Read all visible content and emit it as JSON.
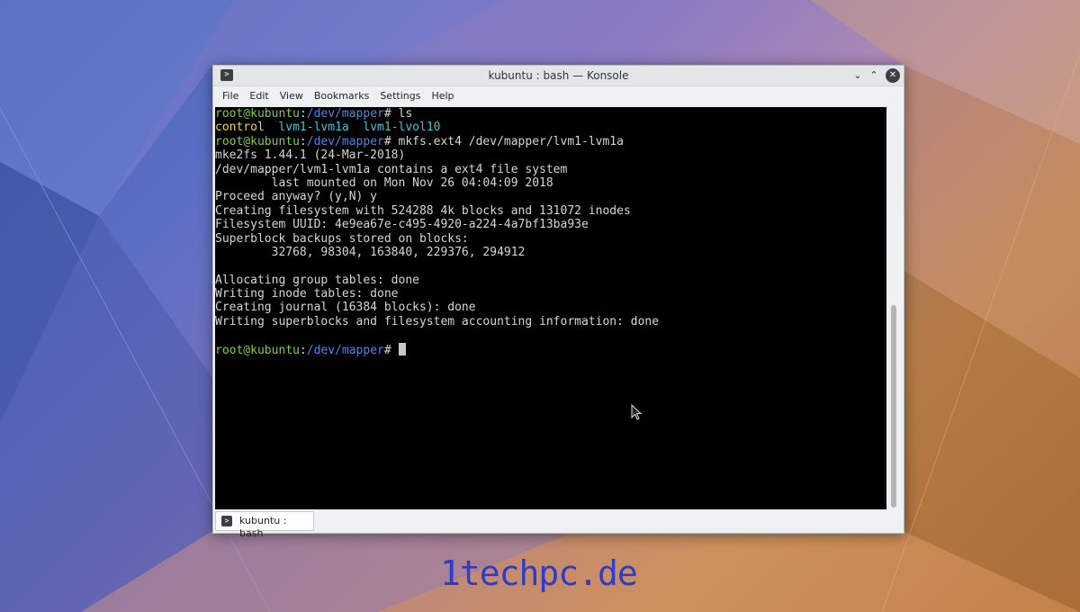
{
  "window": {
    "title": "kubuntu : bash — Konsole",
    "app_icon": "terminal-icon",
    "buttons": [
      "minimize-icon",
      "maximize-icon",
      "close-icon"
    ]
  },
  "menu": [
    "File",
    "Edit",
    "View",
    "Bookmarks",
    "Settings",
    "Help"
  ],
  "terminal": {
    "prompt": {
      "user_host": "root@kubuntu",
      "sep": ":",
      "path": "/dev/mapper",
      "symbol": "# "
    },
    "command1": "ls",
    "ls_output": {
      "control": "control",
      "lvm1": "lvm1-lvm1a",
      "lvol": "lvm1-lvol10"
    },
    "command2": "mkfs.ext4 /dev/mapper/lvm1-lvm1a",
    "output": [
      "mke2fs 1.44.1 (24-Mar-2018)",
      "/dev/mapper/lvm1-lvm1a contains a ext4 file system",
      "        last mounted on Mon Nov 26 04:04:09 2018",
      "Proceed anyway? (y,N) y",
      "Creating filesystem with 524288 4k blocks and 131072 inodes",
      "Filesystem UUID: 4e9ea67e-c495-4920-a224-4a7bf13ba93e",
      "Superblock backups stored on blocks:",
      "        32768, 98304, 163840, 229376, 294912",
      "",
      "Allocating group tables: done",
      "Writing inode tables: done",
      "Creating journal (16384 blocks): done",
      "Writing superblocks and filesystem accounting information: done",
      ""
    ]
  },
  "tab": {
    "label": "kubuntu : bash",
    "icon": "terminal-icon"
  },
  "watermark": "1techpc.de",
  "colors": {
    "prompt_green": "#7fd13b",
    "path_blue": "#4e86e8",
    "terminal_bg": "#000000",
    "watermark_blue": "#2b3ccf"
  }
}
